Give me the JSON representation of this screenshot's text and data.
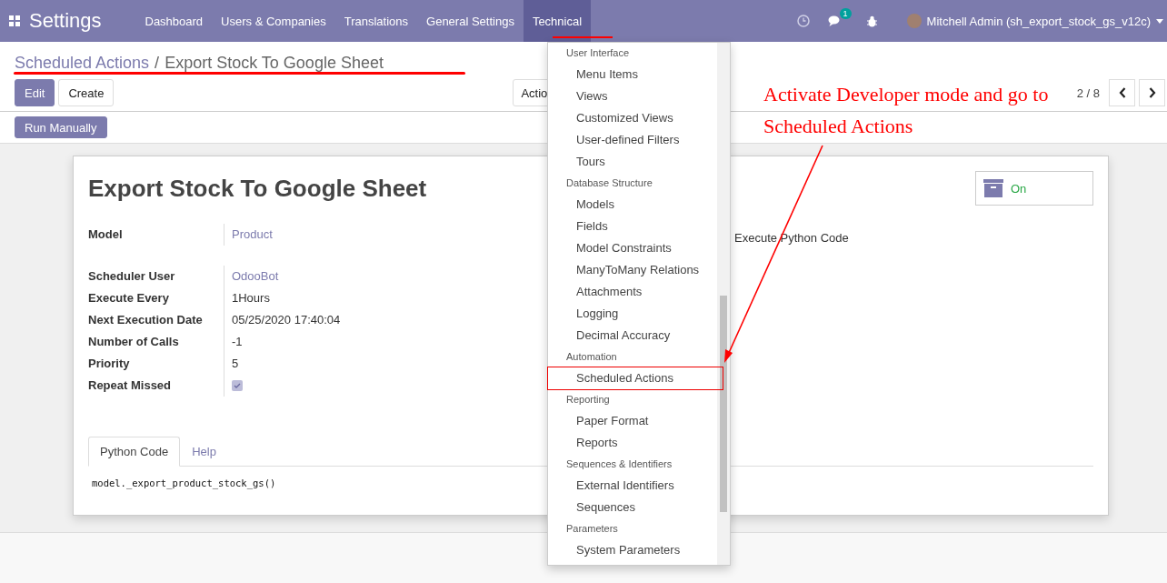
{
  "navbar": {
    "app_title": "Settings",
    "menus": [
      {
        "label": "Dashboard",
        "selected": false
      },
      {
        "label": "Users & Companies",
        "selected": false
      },
      {
        "label": "Translations",
        "selected": false
      },
      {
        "label": "General Settings",
        "selected": false
      },
      {
        "label": "Technical",
        "selected": true
      }
    ],
    "chat_badge": "1",
    "user": "Mitchell Admin (sh_export_stock_gs_v12c)"
  },
  "breadcrumb": {
    "parent": "Scheduled Actions",
    "separator": "/",
    "current": "Export Stock To Google Sheet"
  },
  "buttons": {
    "edit": "Edit",
    "create": "Create",
    "action": "Actio"
  },
  "pager": "2 / 8",
  "status_buttons": [
    "Run Manually"
  ],
  "sheet": {
    "title": "Export Stock To Google Sheet",
    "toggle": {
      "label": "On",
      "on": true
    },
    "groups": [
      [
        {
          "label": "Model",
          "value": "Product",
          "kind": "link"
        }
      ],
      [
        {
          "label": "Scheduler User",
          "value": "OdooBot",
          "kind": "link"
        },
        {
          "label": "Execute Every",
          "value": "1Hours",
          "kind": "text"
        },
        {
          "label": "Next Execution Date",
          "value": "05/25/2020 17:40:04",
          "kind": "text"
        },
        {
          "label": "Number of Calls",
          "value": "-1",
          "kind": "text"
        },
        {
          "label": "Priority",
          "value": "5",
          "kind": "text"
        },
        {
          "label": "Repeat Missed",
          "kind": "checkbox",
          "checked": true
        }
      ]
    ],
    "right_value": "Execute Python Code",
    "tabs": [
      {
        "label": "Python Code",
        "selected": true
      },
      {
        "label": "Help",
        "selected": false
      }
    ],
    "code": "model._export_product_stock_gs()"
  },
  "menu": {
    "sections": [
      {
        "header": "User Interface",
        "items": [
          {
            "label": "Menu Items",
            "highlighted": false
          },
          {
            "label": "Views",
            "highlighted": false
          },
          {
            "label": "Customized Views",
            "highlighted": false
          },
          {
            "label": "User-defined Filters",
            "highlighted": false
          },
          {
            "label": "Tours",
            "highlighted": false
          }
        ]
      },
      {
        "header": "Database Structure",
        "items": [
          {
            "label": "Models",
            "highlighted": false
          },
          {
            "label": "Fields",
            "highlighted": false
          },
          {
            "label": "Model Constraints",
            "highlighted": false
          },
          {
            "label": "ManyToMany Relations",
            "highlighted": false
          },
          {
            "label": "Attachments",
            "highlighted": false
          },
          {
            "label": "Logging",
            "highlighted": false
          },
          {
            "label": "Decimal Accuracy",
            "highlighted": false
          }
        ]
      },
      {
        "header": "Automation",
        "items": [
          {
            "label": "Scheduled Actions",
            "highlighted": true
          }
        ]
      },
      {
        "header": "Reporting",
        "items": [
          {
            "label": "Paper Format",
            "highlighted": false
          },
          {
            "label": "Reports",
            "highlighted": false
          }
        ]
      },
      {
        "header": "Sequences & Identifiers",
        "items": [
          {
            "label": "External Identifiers",
            "highlighted": false
          },
          {
            "label": "Sequences",
            "highlighted": false
          }
        ]
      },
      {
        "header": "Parameters",
        "items": [
          {
            "label": "System Parameters",
            "highlighted": false
          }
        ]
      }
    ]
  },
  "annotation": {
    "text": "Activate Developer mode and go to Scheduled Actions"
  }
}
